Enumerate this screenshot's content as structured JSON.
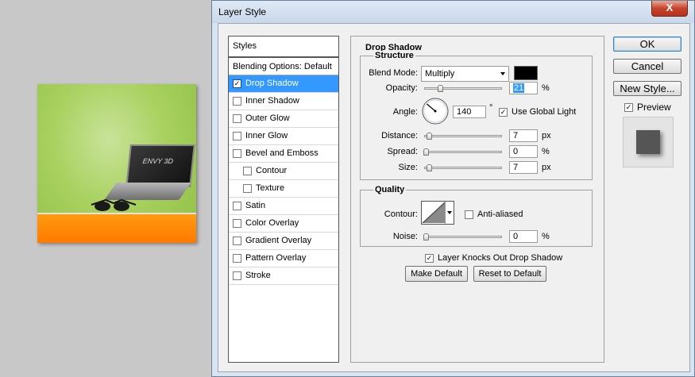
{
  "canvas": {
    "logo_text": "ENVY 3D"
  },
  "dialog": {
    "title": "Layer Style",
    "close_label": "X"
  },
  "styles_panel": {
    "header": "Styles",
    "blending_options": "Blending Options: Default",
    "items": [
      {
        "label": "Drop Shadow",
        "checked": true,
        "selected": true,
        "indent": false
      },
      {
        "label": "Inner Shadow",
        "checked": false,
        "selected": false,
        "indent": false
      },
      {
        "label": "Outer Glow",
        "checked": false,
        "selected": false,
        "indent": false
      },
      {
        "label": "Inner Glow",
        "checked": false,
        "selected": false,
        "indent": false
      },
      {
        "label": "Bevel and Emboss",
        "checked": false,
        "selected": false,
        "indent": false
      },
      {
        "label": "Contour",
        "checked": false,
        "selected": false,
        "indent": true
      },
      {
        "label": "Texture",
        "checked": false,
        "selected": false,
        "indent": true
      },
      {
        "label": "Satin",
        "checked": false,
        "selected": false,
        "indent": false
      },
      {
        "label": "Color Overlay",
        "checked": false,
        "selected": false,
        "indent": false
      },
      {
        "label": "Gradient Overlay",
        "checked": false,
        "selected": false,
        "indent": false
      },
      {
        "label": "Pattern Overlay",
        "checked": false,
        "selected": false,
        "indent": false
      },
      {
        "label": "Stroke",
        "checked": false,
        "selected": false,
        "indent": false
      }
    ]
  },
  "drop_shadow": {
    "section_title": "Drop Shadow",
    "structure": {
      "title": "Structure",
      "blend_mode_label": "Blend Mode:",
      "blend_mode_value": "Multiply",
      "shadow_color": "#000000",
      "opacity_label": "Opacity:",
      "opacity_value": "21",
      "opacity_unit": "%",
      "angle_label": "Angle:",
      "angle_value": "140",
      "angle_unit": "°",
      "use_global_light_label": "Use Global Light",
      "use_global_light": true,
      "distance_label": "Distance:",
      "distance_value": "7",
      "distance_unit": "px",
      "spread_label": "Spread:",
      "spread_value": "0",
      "spread_unit": "%",
      "size_label": "Size:",
      "size_value": "7",
      "size_unit": "px"
    },
    "quality": {
      "title": "Quality",
      "contour_label": "Contour:",
      "anti_aliased_label": "Anti-aliased",
      "anti_aliased": false,
      "noise_label": "Noise:",
      "noise_value": "0",
      "noise_unit": "%"
    },
    "knocks_out_label": "Layer Knocks Out Drop Shadow",
    "knocks_out": true,
    "make_default_label": "Make Default",
    "reset_default_label": "Reset to Default"
  },
  "actions": {
    "ok_label": "OK",
    "cancel_label": "Cancel",
    "new_style_label": "New Style...",
    "preview_label": "Preview",
    "preview_checked": true
  }
}
